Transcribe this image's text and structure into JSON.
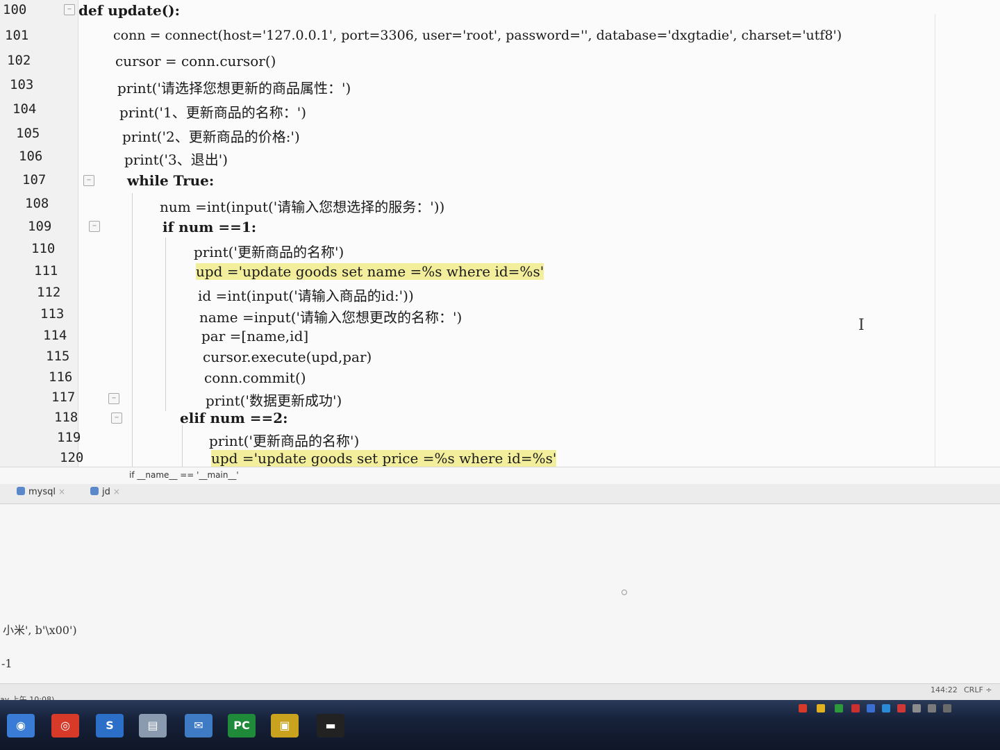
{
  "editor": {
    "lines": [
      {
        "num": "100",
        "code": "def update():"
      },
      {
        "num": "101",
        "code": "conn = connect(host='127.0.0.1', port=3306, user='root', password='', database='dxgtadie', charset='utf8')"
      },
      {
        "num": "102",
        "code": "cursor = conn.cursor()"
      },
      {
        "num": "103",
        "code": "print('请选择您想更新的商品属性：')"
      },
      {
        "num": "104",
        "code": "print('1、更新商品的名称：')"
      },
      {
        "num": "105",
        "code": "print('2、更新商品的价格:')"
      },
      {
        "num": "106",
        "code": "print('3、退出')"
      },
      {
        "num": "107",
        "code": "while True:"
      },
      {
        "num": "108",
        "code": "num =int(input('请输入您想选择的服务：'))"
      },
      {
        "num": "109",
        "code": "if num ==1:"
      },
      {
        "num": "110",
        "code": "print('更新商品的名称')"
      },
      {
        "num": "111",
        "code": "upd ='update goods set name =%s where id=%s'"
      },
      {
        "num": "112",
        "code": "id =int(input('请输入商品的id:'))"
      },
      {
        "num": "113",
        "code": "name =input('请输入您想更改的名称：')"
      },
      {
        "num": "114",
        "code": "par =[name,id]"
      },
      {
        "num": "115",
        "code": "cursor.execute(upd,par)"
      },
      {
        "num": "116",
        "code": "conn.commit()"
      },
      {
        "num": "117",
        "code": "print('数据更新成功')"
      },
      {
        "num": "118",
        "code": "elif num ==2:"
      },
      {
        "num": "119",
        "code": "print('更新商品的名称')"
      },
      {
        "num": "120",
        "code": "upd ='update goods set price =%s where id=%s'"
      }
    ],
    "breadcrumb": "if __name__ == '__main__'"
  },
  "tabs": [
    {
      "label": "mysql"
    },
    {
      "label": "jd"
    }
  ],
  "console": {
    "line1": "小米', b'\\x00')",
    "line2": "-1"
  },
  "status": {
    "position": "144:22",
    "line_ending": "CRLF ÷",
    "event_log": "ay 上午 10:08)"
  },
  "taskbar": {
    "pycharm_label": "PC"
  },
  "colors": {
    "highlight": "#f3ee9c",
    "taskbar": "#16213a",
    "keyword": "#000080"
  }
}
